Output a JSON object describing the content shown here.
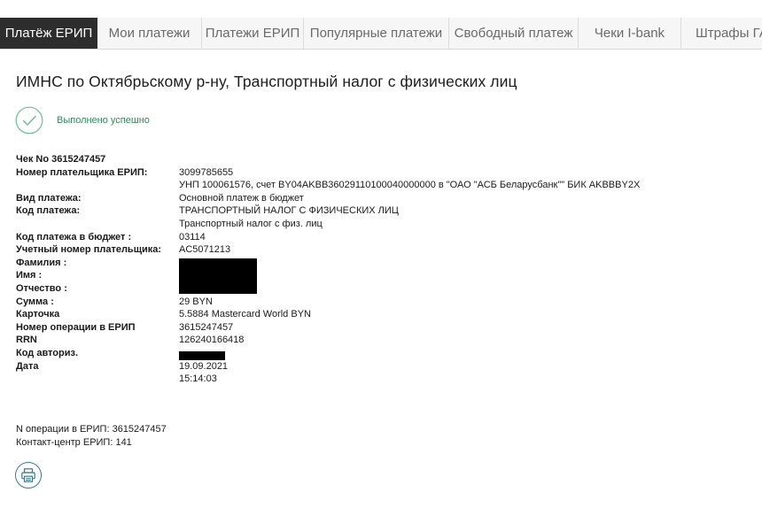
{
  "tabs": [
    {
      "label": "Платёж ЕРИП",
      "active": true
    },
    {
      "label": "Мои платежи",
      "active": false
    },
    {
      "label": "Платежи ЕРИП",
      "active": false
    },
    {
      "label": "Популярные платежи",
      "active": false
    },
    {
      "label": "Свободный платеж",
      "active": false
    },
    {
      "label": "Чеки I-bank",
      "active": false
    },
    {
      "label": "Штрафы ГАИ",
      "active": false
    }
  ],
  "page_title": "ИМНС по Октябрьскому р-ну, Транспортный налог с физических лиц",
  "status": {
    "text": "Выполнено успешно",
    "color": "#2e8b5a",
    "icon": "check-circle-icon"
  },
  "receipt": {
    "check_label": "Чек No 3615247457",
    "rows": [
      {
        "label": "Номер плательщика ЕРИП:",
        "value": "3099785655"
      },
      {
        "label": "",
        "value": "УНП 100061576, счет BY04AKBB36029110100040000000 в \"ОАО \"АСБ Беларусбанк\"\" БИК AKBBBY2X"
      },
      {
        "label": "Вид платежа:",
        "value": "Основной платеж в бюджет"
      },
      {
        "label": "Код платежа:",
        "value": "ТРАНСПОРТНЫЙ НАЛОГ С ФИЗИЧЕСКИХ ЛИЦ"
      },
      {
        "label": "",
        "value": "Транспортный налог с физ. лиц"
      },
      {
        "label": "Код платежа в бюджет :",
        "value": "03114"
      },
      {
        "label": "Учетный номер плательщика:",
        "value": "AC5071213"
      },
      {
        "label": "Фамилия :",
        "value": ""
      },
      {
        "label": "Имя :",
        "value": ""
      },
      {
        "label": "Отчество :",
        "value": ""
      },
      {
        "label": "Сумма :",
        "value": "29 BYN"
      },
      {
        "label": "Карточка",
        "value": "5.5884 Mastercard World BYN"
      },
      {
        "label": "Номер операции в ЕРИП",
        "value": "3615247457"
      },
      {
        "label": "RRN",
        "value": "126240166418"
      },
      {
        "label": "Код авториз.",
        "value": ""
      },
      {
        "label": "Дата",
        "value": "19.09.2021"
      },
      {
        "label": "",
        "value": "15:14:03"
      }
    ]
  },
  "footer": {
    "operation": "N операции в ЕРИП: 3615247457",
    "contact": "Контакт-центр ЕРИП: 141"
  },
  "print_button": {
    "icon": "printer-icon"
  },
  "colors": {
    "active_tab": "#2d2d2d",
    "success": "#2e8b5a",
    "print_icon": "#3a7a8c"
  }
}
